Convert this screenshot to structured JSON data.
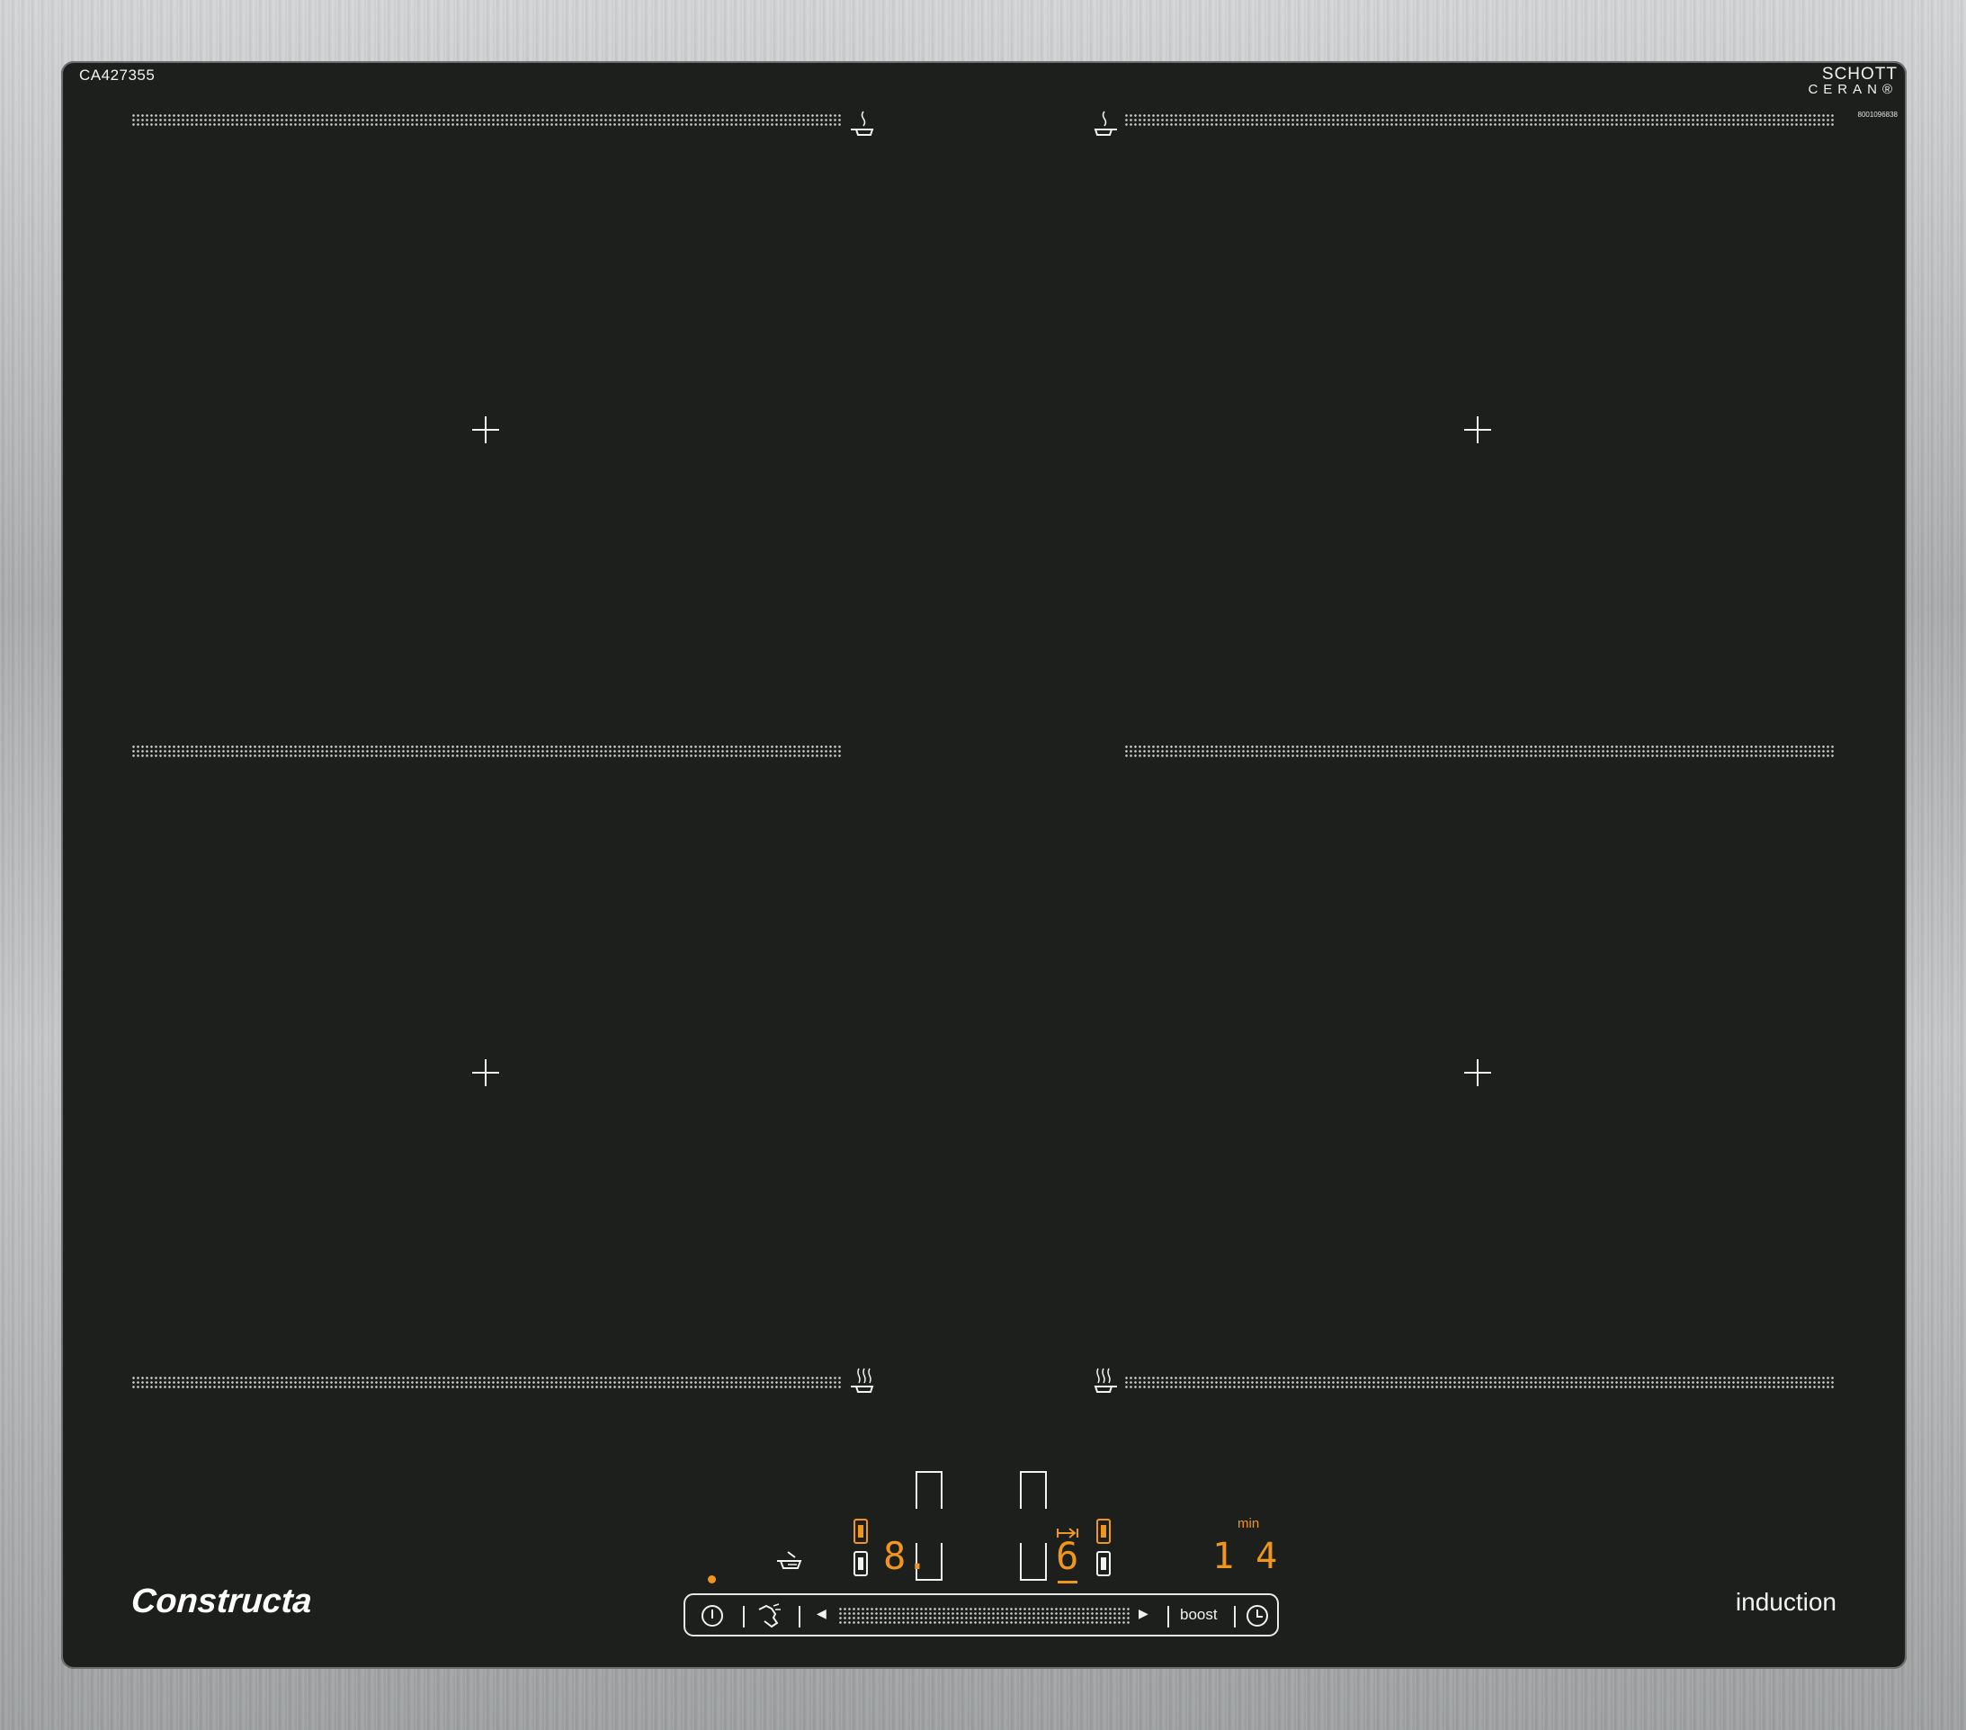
{
  "hob": {
    "model": "CA427355",
    "glass_brand_line1": "SCHOTT",
    "glass_brand_line2": "CERAN®",
    "serial": "8001096838",
    "brand": "Constructa",
    "technology": "induction"
  },
  "controls": {
    "power_icon": "power-icon",
    "cleaning_icon": "wipe-protection-icon",
    "left_arrow": "◀",
    "right_arrow": "▶",
    "boost_label": "boost",
    "timer_icon": "clock-icon"
  },
  "display": {
    "left_zone_level": "8.",
    "right_zone_level": "6",
    "timer_value": "1 4",
    "timer_unit": "min",
    "indicator_color": "#f0961c"
  },
  "colors": {
    "glass": "#1d1f1c",
    "frame": "#b8babb",
    "accent": "#f0961c",
    "print": "#f2f2f2"
  }
}
